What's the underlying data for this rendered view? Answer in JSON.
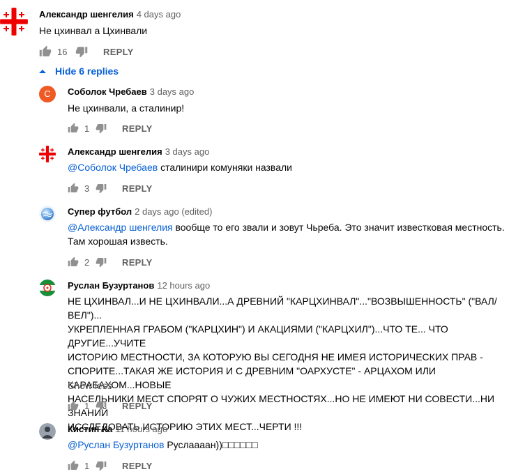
{
  "top_comment": {
    "author": "Александр шенгелия",
    "time": "4 days ago",
    "text": "Не цхинвал а Цхинвали",
    "likes": "16",
    "reply_label": "REPLY"
  },
  "hide_replies_label": "Hide 6 replies",
  "show_less_label": "Show less",
  "replies": [
    {
      "author": "Соболок Чребаев",
      "time": "3 days ago",
      "avatar_letter": "С",
      "avatar_color": "#ef5a24",
      "text": "Не цхинвали, а сталинир!",
      "likes": "1",
      "reply_label": "REPLY"
    },
    {
      "author": "Александр шенгелия",
      "time": "3 days ago",
      "mention": "@Соболок Чребаев",
      "text": " сталинири комуняки назвали",
      "likes": "3",
      "reply_label": "REPLY"
    },
    {
      "author": "Супер футбол",
      "time": "2 days ago (edited)",
      "mention": "@Александр шенгелия",
      "text_line1": " вообще то  его звали и зовут Чьреба. Это значит известковая местность.",
      "text_line2": "Там  хорошая известь.",
      "likes": "2",
      "reply_label": "REPLY"
    },
    {
      "author": "Руслан Бузуртанов",
      "time": "12 hours ago",
      "lines": [
        "НЕ ЦХИНВАЛ...И НЕ ЦХИНВАЛИ...А ДРЕВНИЙ  \"КАРЦХИНВАЛ\"...\"ВОЗВЫШЕННОСТЬ\" (\"ВАЛ/ВЕЛ\")...",
        "УКРЕПЛЕННАЯ ГРАБОМ  (\"КАРЦХИН\")  И АКАЦИЯМИ (\"КАРЦХИЛ\")...ЧТО ТЕ... ЧТО ДРУГИЕ...УЧИТЕ",
        "ИСТОРИЮ МЕСТНОСТИ, ЗА КОТОРУЮ ВЫ СЕГОДНЯ  НЕ ИМЕЯ ИСТОРИЧЕСКИХ ПРАВ -",
        "СПОРИТЕ...ТАКАЯ ЖЕ ИСТОРИЯ И С ДРЕВНИМ \"ОАРХУСТЕ\" - АРЦАХОМ ИЛИ КАРАБАХОМ...НОВЫЕ",
        "НАСЕЛЬНИКИ МЕСТ СПОРЯТ О ЧУЖИХ МЕСТНОСТЯХ...НО НЕ ИМЕЮТ НИ СОВЕСТИ...НИ ЗНАНИЙ",
        "ИССЛЕДОВАТЬ ИСТОРИЮ ЭТИХ МЕСТ...ЧЕРТИ !!!"
      ],
      "likes": "1",
      "reply_label": "REPLY"
    },
    {
      "author": "Кистин Ка",
      "time": "11 hours ago",
      "mention": "@Руслан Бузуртанов",
      "text": " Руслаааан))□□□□□□",
      "likes": "1",
      "reply_label": "REPLY"
    }
  ]
}
